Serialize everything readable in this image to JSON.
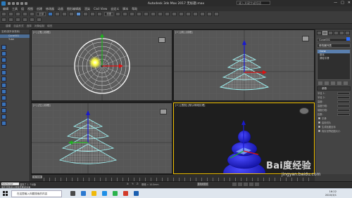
{
  "window": {
    "title": "Autodesk 3ds Max 2017    无标题.max",
    "search_placeholder": "键入关键字或短语",
    "controls": [
      "—",
      "□",
      "✕"
    ]
  },
  "menu": [
    "编辑",
    "工具",
    "组",
    "视图",
    "创建",
    "修改器",
    "动画",
    "图形编辑器",
    "渲染",
    "Civil View",
    "自定义",
    "脚本",
    "帮助"
  ],
  "toolbar": {
    "selection_filter": "全部",
    "view_dropdown": "视图"
  },
  "ribbon": {
    "tabs": [
      "建模",
      "自由形式",
      "选择",
      "对象绘制",
      "填充"
    ]
  },
  "scene_explorer": {
    "header": "名称(按升序排序)",
    "items": [
      "Cone001",
      "Tube"
    ]
  },
  "viewports": [
    {
      "label": "[+] [顶] [线框]"
    },
    {
      "label": "[+] [前] [线框]"
    },
    {
      "label": "[+] [左] [线框]"
    },
    {
      "label": "[+] [透视] [默认明暗处理]"
    }
  ],
  "command_panel": {
    "object_name": "Cone001",
    "modifier_list_label": "修改器列表",
    "stack_items": [
      "Cone",
      "锥化",
      "涡轮平滑"
    ],
    "rollouts": [
      "参数"
    ],
    "params": [
      {
        "label": "半径 1:",
        "value": ""
      },
      {
        "label": "半径 2:",
        "value": ""
      },
      {
        "label": "高度:",
        "value": ""
      },
      {
        "label": "高度分段:",
        "value": ""
      },
      {
        "label": "端面分段:",
        "value": ""
      },
      {
        "label": "边数:",
        "value": ""
      }
    ],
    "checks": [
      "平滑",
      "启用切片",
      "生成贴图坐标",
      "真实世界贴图大小"
    ]
  },
  "timeline": {
    "slider": "0 / 100"
  },
  "status": {
    "script_box": "MAXScript",
    "selected": "选择了 1 个对象",
    "prompt": "单击并拖动以选择并移动对象",
    "coords": [
      "X:",
      "Y:",
      "Z:",
      "栅格 = 10.0mm"
    ],
    "autokey": "自动关键点"
  },
  "taskbar": {
    "search_text": "在这里输入你要搜索的内容",
    "time": "16:22",
    "date": "2020/3/1"
  },
  "watermark": {
    "logo": "Bai度经验",
    "url": "jingyan.baidu.com"
  },
  "colors": {
    "active_viewport": "#f0c000",
    "object_blue": "#2424d0",
    "wire_white": "#ffffff"
  }
}
